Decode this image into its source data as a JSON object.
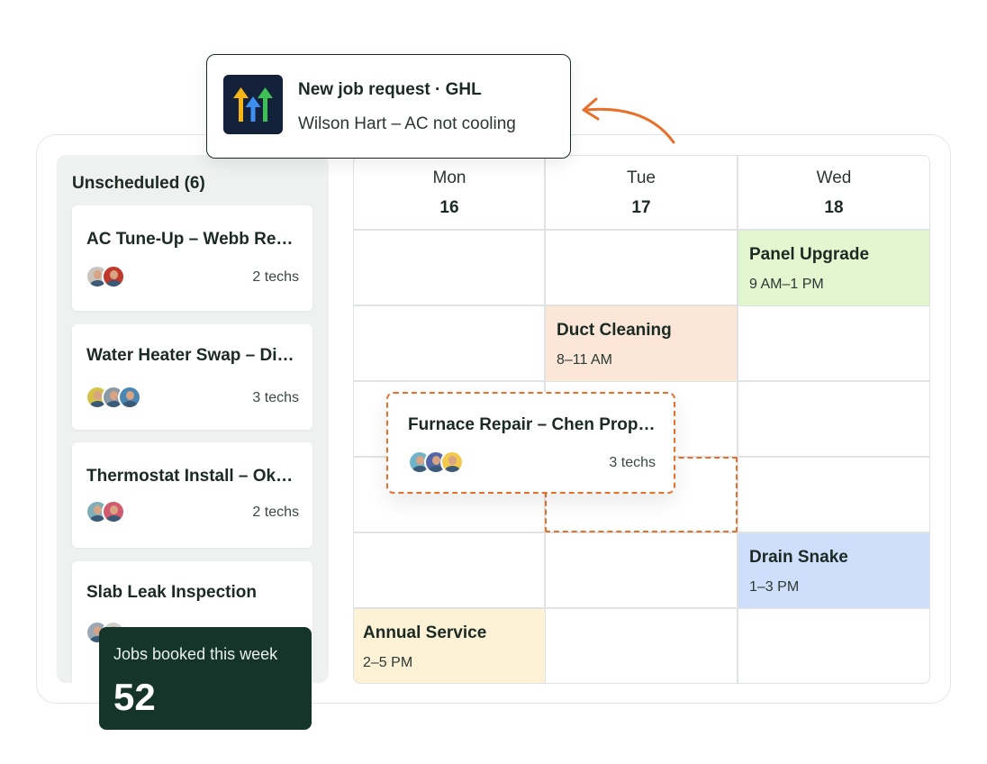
{
  "notification": {
    "title": "New job request · GHL",
    "message": "Wilson Hart – AC not cooling",
    "logo_icon": "ghl-arrows-logo",
    "logo_colors": [
      "#f5b616",
      "#3d8ff0",
      "#3ec154"
    ]
  },
  "unscheduled": {
    "title": "Unscheduled (6)",
    "cards": [
      {
        "title": "AC Tune-Up – Webb Residence",
        "techs": "2 techs",
        "avatar_colors": [
          "#c9c3bb",
          "#c0392b"
        ]
      },
      {
        "title": "Water Heater Swap – Dixon Home",
        "techs": "3 techs",
        "avatar_colors": [
          "#d4c24a",
          "#8c9aa6",
          "#4a87b3"
        ]
      },
      {
        "title": "Thermostat Install – Okafor Residence",
        "techs": "2 techs",
        "avatar_colors": [
          "#7fb0b7",
          "#d05a6e"
        ]
      },
      {
        "title": "Slab Leak Inspection",
        "techs": "",
        "avatar_colors": [
          "#9aa8b5",
          "#cfcfcf"
        ]
      }
    ]
  },
  "calendar": {
    "days": [
      {
        "name": "Mon",
        "date": "16"
      },
      {
        "name": "Tue",
        "date": "17"
      },
      {
        "name": "Wed",
        "date": "18"
      }
    ],
    "events": [
      {
        "title": "Panel Upgrade",
        "time": "9 AM–1 PM",
        "color": "#e2f7cf"
      },
      {
        "title": "Duct Cleaning",
        "time": "8–11 AM",
        "color": "#fbe6d8"
      },
      {
        "title": "Drain Snake",
        "time": "1–3 PM",
        "color": "#cfdffb"
      },
      {
        "title": "Annual Service",
        "time": "2–5 PM",
        "color": "#fdf1d6"
      }
    ]
  },
  "dragging": {
    "title": "Furnace Repair – Chen Properties",
    "techs": "3 techs",
    "avatar_colors": [
      "#6fb3c9",
      "#5566a8",
      "#f2c94c"
    ],
    "accent": "#e8702a"
  },
  "stats": {
    "label": "Jobs booked this week",
    "value": "52"
  }
}
